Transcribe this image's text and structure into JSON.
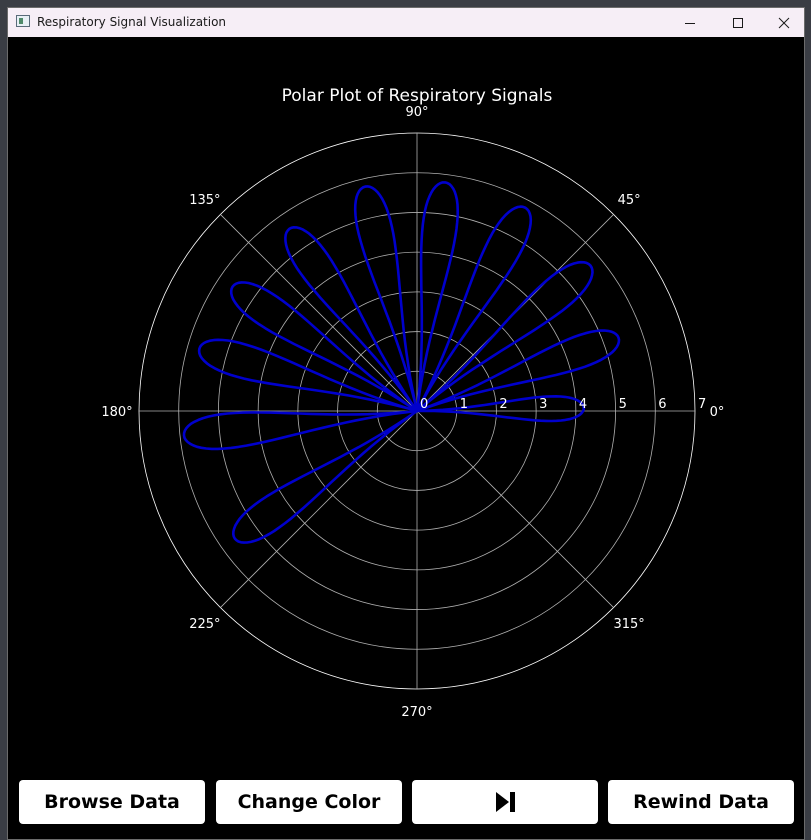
{
  "window": {
    "title": "Respiratory Signal Visualization"
  },
  "buttons": {
    "browse": "Browse Data",
    "change_color": "Change Color",
    "play_icon": "skip-forward-icon",
    "rewind": "Rewind Data"
  },
  "chart_data": {
    "type": "line",
    "projection": "polar",
    "title": "Polar Plot of Respiratory Signals",
    "angle_ticks": [
      "0°",
      "45°",
      "90°",
      "135°",
      "180°",
      "225°",
      "270°",
      "315°"
    ],
    "radial_ticks": [
      "0",
      "1",
      "2",
      "3",
      "4",
      "5",
      "6",
      "7"
    ],
    "rlim": [
      0,
      7
    ],
    "grid": true,
    "series_color": "#0000cc",
    "background": "#000000",
    "theta_range_deg": [
      0,
      225
    ],
    "petals": [
      {
        "center_deg": 1,
        "max_r": 4.2
      },
      {
        "center_deg": 20,
        "max_r": 5.4
      },
      {
        "center_deg": 40,
        "max_r": 5.7
      },
      {
        "center_deg": 62,
        "max_r": 5.8
      },
      {
        "center_deg": 83,
        "max_r": 5.8
      },
      {
        "center_deg": 103,
        "max_r": 5.8
      },
      {
        "center_deg": 125,
        "max_r": 5.6
      },
      {
        "center_deg": 146,
        "max_r": 5.6
      },
      {
        "center_deg": 164,
        "max_r": 5.7
      },
      {
        "center_deg": 186,
        "max_r": 5.9
      },
      {
        "center_deg": 215,
        "max_r": 5.6
      }
    ]
  }
}
